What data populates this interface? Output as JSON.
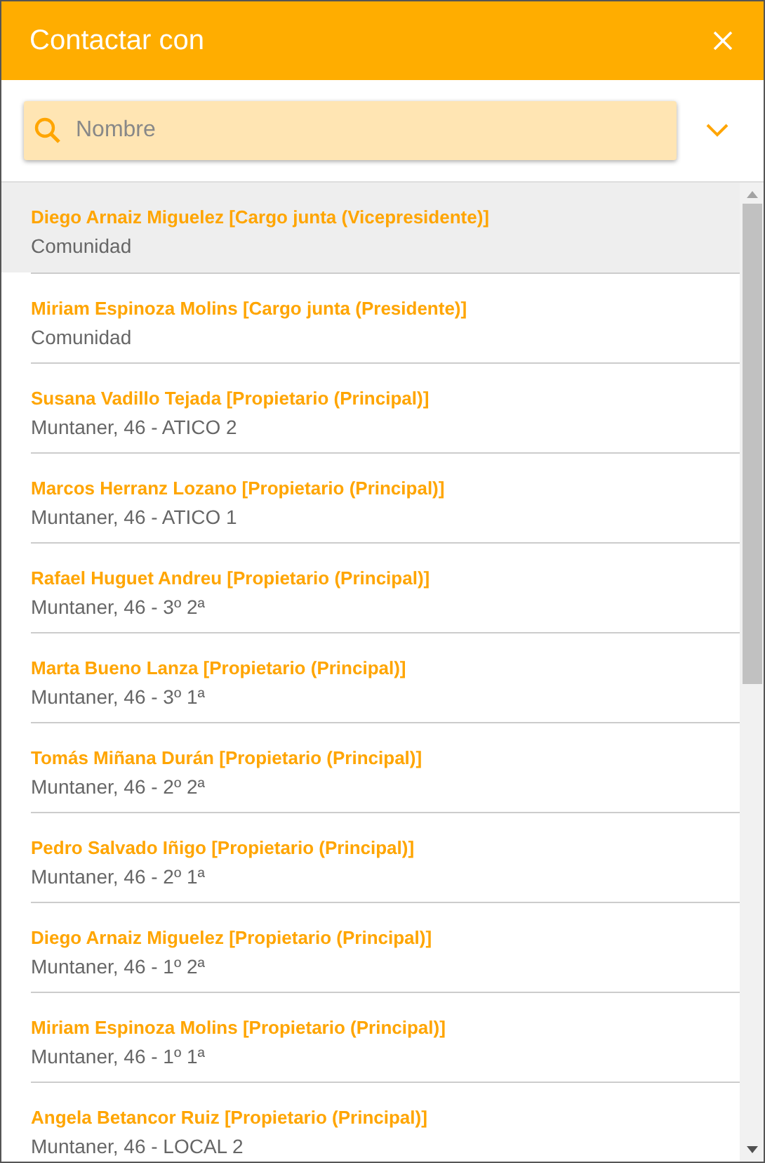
{
  "dialog": {
    "title": "Contactar con"
  },
  "search": {
    "placeholder": "Nombre"
  },
  "contacts": [
    {
      "name": "Diego Arnaiz Miguelez [Cargo junta (Vicepresidente)]",
      "detail": "Comunidad",
      "selected": true
    },
    {
      "name": "Miriam Espinoza Molins [Cargo junta (Presidente)]",
      "detail": "Comunidad",
      "selected": false
    },
    {
      "name": "Susana Vadillo Tejada [Propietario (Principal)]",
      "detail": "Muntaner, 46 - ATICO 2",
      "selected": false
    },
    {
      "name": "Marcos Herranz Lozano [Propietario (Principal)]",
      "detail": "Muntaner, 46 - ATICO 1",
      "selected": false
    },
    {
      "name": "Rafael Huguet Andreu [Propietario (Principal)]",
      "detail": "Muntaner, 46 - 3º 2ª",
      "selected": false
    },
    {
      "name": "Marta Bueno Lanza [Propietario (Principal)]",
      "detail": "Muntaner, 46 - 3º 1ª",
      "selected": false
    },
    {
      "name": "Tomás Miñana Durán [Propietario (Principal)]",
      "detail": "Muntaner, 46 - 2º 2ª",
      "selected": false
    },
    {
      "name": "Pedro Salvado Iñigo [Propietario (Principal)]",
      "detail": "Muntaner, 46 - 2º 1ª",
      "selected": false
    },
    {
      "name": "Diego Arnaiz Miguelez [Propietario (Principal)]",
      "detail": "Muntaner, 46 - 1º 2ª",
      "selected": false
    },
    {
      "name": "Miriam Espinoza Molins [Propietario (Principal)]",
      "detail": "Muntaner, 46 - 1º 1ª",
      "selected": false
    },
    {
      "name": "Angela Betancor Ruiz [Propietario (Principal)]",
      "detail": "Muntaner, 46 - LOCAL 2",
      "selected": false
    }
  ]
}
